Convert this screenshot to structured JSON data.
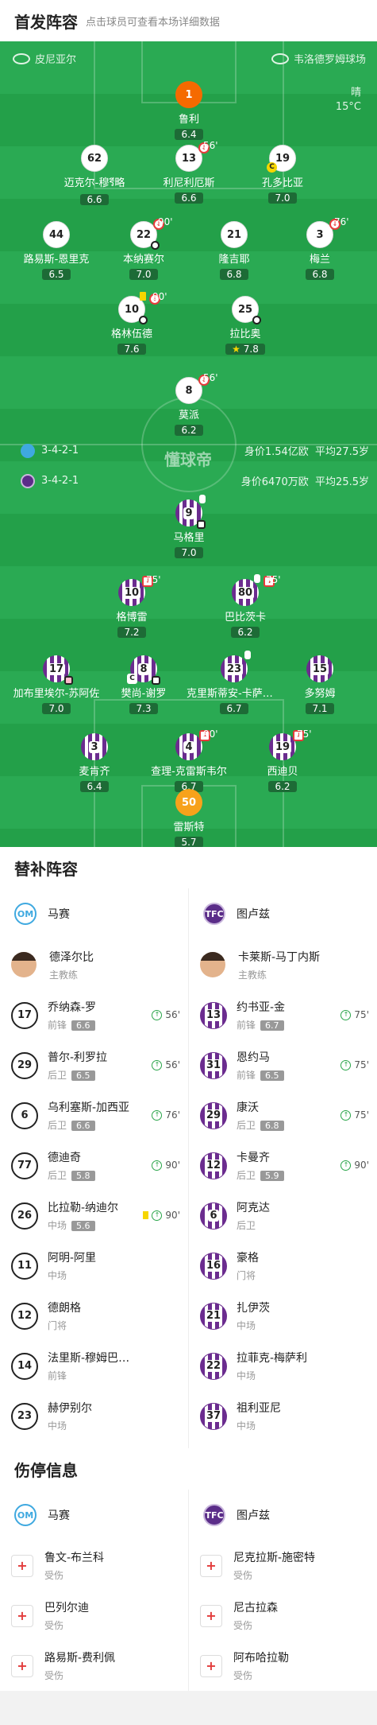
{
  "header": {
    "title": "首发阵容",
    "subtitle": "点击球员可查看本场详细数据"
  },
  "pitch": {
    "home_team": "皮尼亚尔",
    "away_team": "韦洛德罗姆球场",
    "weather": "晴",
    "temperature": "15°C",
    "watermark": "懂球帝"
  },
  "home": {
    "formation": "3-4-2-1",
    "value": "身价1.54亿欧",
    "avg_age": "平均27.5岁",
    "players": [
      {
        "num": "1",
        "name": "鲁利",
        "rating": "6.4"
      },
      {
        "num": "62",
        "name": "迈克尔-穆รี略",
        "rating": "6.6"
      },
      {
        "num": "13",
        "name": "利尼利厄斯",
        "rating": "6.6",
        "sub": "56'"
      },
      {
        "num": "19",
        "name": "孔多比亚",
        "rating": "7.0"
      },
      {
        "num": "44",
        "name": "路易斯-恩里克",
        "rating": "6.5"
      },
      {
        "num": "22",
        "name": "本纳赛尔",
        "rating": "7.0",
        "sub": "90'"
      },
      {
        "num": "21",
        "name": "隆吉耶",
        "rating": "6.8"
      },
      {
        "num": "3",
        "name": "梅兰",
        "rating": "6.8",
        "sub": "76'"
      },
      {
        "num": "10",
        "name": "格林伍德",
        "rating": "7.6",
        "sub": "90'"
      },
      {
        "num": "25",
        "name": "拉比奥",
        "rating": "7.8"
      },
      {
        "num": "8",
        "name": "莫派",
        "rating": "6.2",
        "sub": "56'"
      }
    ]
  },
  "away": {
    "formation": "3-4-2-1",
    "value": "身价6470万欧",
    "avg_age": "平均25.5岁",
    "players": [
      {
        "num": "9",
        "name": "马格里",
        "rating": "7.0"
      },
      {
        "num": "10",
        "name": "格博雷",
        "rating": "7.2",
        "sub": "75'"
      },
      {
        "num": "80",
        "name": "巴比茨卡",
        "rating": "6.2",
        "sub": "75'"
      },
      {
        "num": "17",
        "name": "加布里埃尔-苏阿佐",
        "rating": "7.0"
      },
      {
        "num": "8",
        "name": "樊尚-谢罗",
        "rating": "7.3"
      },
      {
        "num": "23",
        "name": "克里斯蒂安-卡萨雷斯",
        "rating": "6.7"
      },
      {
        "num": "15",
        "name": "多努姆",
        "rating": "7.1"
      },
      {
        "num": "3",
        "name": "麦肯齐",
        "rating": "6.4"
      },
      {
        "num": "4",
        "name": "查理-克雷斯韦尔",
        "rating": "6.7",
        "sub": "90'"
      },
      {
        "num": "19",
        "name": "西迪贝",
        "rating": "6.2",
        "sub": "75'"
      },
      {
        "num": "50",
        "name": "雷斯特",
        "rating": "5.7"
      }
    ]
  },
  "subs": {
    "title": "替补阵容",
    "home_team": "马赛",
    "away_team": "图卢兹",
    "home_coach": {
      "name": "德泽尔比",
      "role": "主教练"
    },
    "away_coach": {
      "name": "卡莱斯-马丁内斯",
      "role": "主教练"
    },
    "home": [
      {
        "num": "17",
        "name": "乔纳森-罗",
        "pos": "前锋",
        "rating": "6.6",
        "time": "56'"
      },
      {
        "num": "29",
        "name": "普尔-利罗拉",
        "pos": "后卫",
        "rating": "6.5",
        "time": "56'"
      },
      {
        "num": "6",
        "name": "乌利塞斯-加西亚",
        "pos": "后卫",
        "rating": "6.6",
        "time": "76'"
      },
      {
        "num": "77",
        "name": "德迪奇",
        "pos": "后卫",
        "rating": "5.8",
        "time": "90'"
      },
      {
        "num": "26",
        "name": "比拉勒-纳迪尔",
        "pos": "中场",
        "rating": "5.6",
        "time": "90'"
      },
      {
        "num": "11",
        "name": "阿明-阿里",
        "pos": "中场"
      },
      {
        "num": "12",
        "name": "德朗格",
        "pos": "门将"
      },
      {
        "num": "14",
        "name": "法里斯-穆姆巴尼亚",
        "pos": "前锋"
      },
      {
        "num": "23",
        "name": "赫伊别尔",
        "pos": "中场"
      }
    ],
    "away": [
      {
        "num": "13",
        "name": "约书亚-金",
        "pos": "前锋",
        "rating": "6.7",
        "time": "75'"
      },
      {
        "num": "31",
        "name": "恩约马",
        "pos": "前锋",
        "rating": "6.5",
        "time": "75'"
      },
      {
        "num": "29",
        "name": "康沃",
        "pos": "后卫",
        "rating": "6.8",
        "time": "75'"
      },
      {
        "num": "12",
        "name": "卡曼齐",
        "pos": "后卫",
        "rating": "5.9",
        "time": "90'"
      },
      {
        "num": "6",
        "name": "阿克达",
        "pos": "后卫"
      },
      {
        "num": "16",
        "name": "豪格",
        "pos": "门将"
      },
      {
        "num": "21",
        "name": "扎伊茨",
        "pos": "中场"
      },
      {
        "num": "22",
        "name": "拉菲克-梅萨利",
        "pos": "中场"
      },
      {
        "num": "37",
        "name": "祖利亚尼",
        "pos": "中场"
      }
    ]
  },
  "injuries": {
    "title": "伤停信息",
    "home_team": "马赛",
    "away_team": "图卢兹",
    "home": [
      {
        "name": "鲁文-布兰科",
        "status": "受伤"
      },
      {
        "name": "巴列尔迪",
        "status": "受伤"
      },
      {
        "name": "路易斯-费利佩",
        "status": "受伤"
      }
    ],
    "away": [
      {
        "name": "尼克拉斯-施密特",
        "status": "受伤"
      },
      {
        "name": "尼古拉森",
        "status": "受伤"
      },
      {
        "name": "阿布哈拉勒",
        "status": "受伤"
      }
    ]
  }
}
